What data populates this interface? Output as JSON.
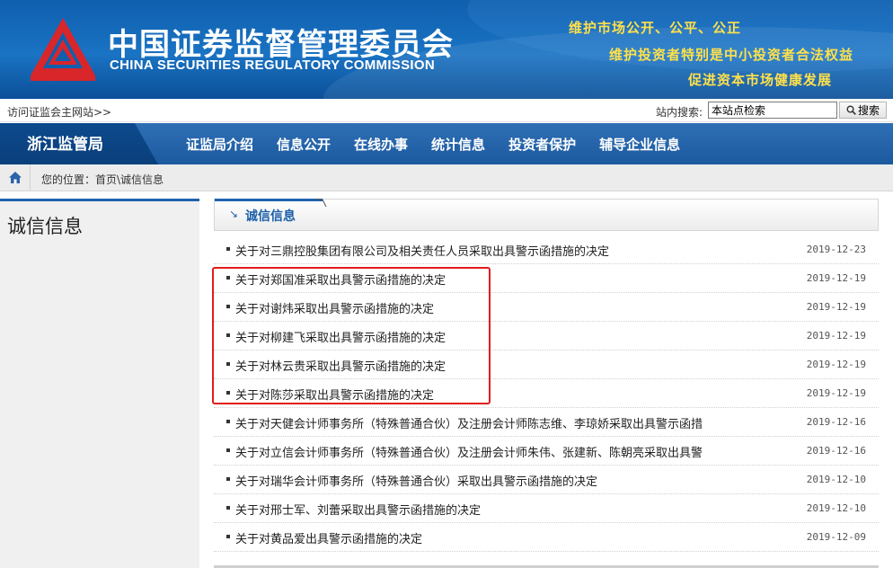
{
  "header": {
    "org_name_cn": "中国证券监督管理委员会",
    "org_name_en": "CHINA SECURITIES REGULATORY COMMISSION",
    "slogans": [
      "维护市场公开、公平、公正",
      "维护投资者特别是中小投资者合法权益",
      "促进资本市场健康发展"
    ],
    "logo_icon": "csrc-logo-icon"
  },
  "topbar": {
    "visit_link": "访问证监会主网站>>",
    "search_label": "站内搜索:",
    "search_value": "本站点检索",
    "search_button": "搜索",
    "search_icon": "magnifier-icon"
  },
  "nav": {
    "region": "浙江监管局",
    "items": [
      "证监局介绍",
      "信息公开",
      "在线办事",
      "统计信息",
      "投资者保护",
      "辅导企业信息"
    ]
  },
  "breadcrumb": {
    "home_icon": "home-icon",
    "text": "您的位置：首页\\诚信信息"
  },
  "sidebar": {
    "title": "诚信信息"
  },
  "section": {
    "title": "诚信信息",
    "arrow_icon": "corner-arrow-icon"
  },
  "news": [
    {
      "title": "关于对三鼎控股集团有限公司及相关责任人员采取出具警示函措施的决定",
      "date": "2019-12-23"
    },
    {
      "title": "关于对郑国准采取出具警示函措施的决定",
      "date": "2019-12-19"
    },
    {
      "title": "关于对谢炜采取出具警示函措施的决定",
      "date": "2019-12-19"
    },
    {
      "title": "关于对柳建飞采取出具警示函措施的决定",
      "date": "2019-12-19"
    },
    {
      "title": "关于对林云贵采取出具警示函措施的决定",
      "date": "2019-12-19"
    },
    {
      "title": "关于对陈莎采取出具警示函措施的决定",
      "date": "2019-12-19"
    },
    {
      "title": "关于对天健会计师事务所（特殊普通合伙）及注册会计师陈志维、李琼娇采取出具警示函措",
      "date": "2019-12-16"
    },
    {
      "title": "关于对立信会计师事务所（特殊普通合伙）及注册会计师朱伟、张建新、陈朝亮采取出具警",
      "date": "2019-12-16"
    },
    {
      "title": "关于对瑞华会计师事务所（特殊普通合伙）采取出具警示函措施的决定",
      "date": "2019-12-10"
    },
    {
      "title": "关于对邢士军、刘蕾采取出具警示函措施的决定",
      "date": "2019-12-10"
    },
    {
      "title": "关于对黄品爱出具警示函措施的决定",
      "date": "2019-12-09"
    }
  ],
  "colors": {
    "banner_blue": "#1a73c3",
    "nav_blue": "#2f6fb4",
    "slogan_yellow": "#ffe14a",
    "highlight_red": "#e21b1b"
  }
}
